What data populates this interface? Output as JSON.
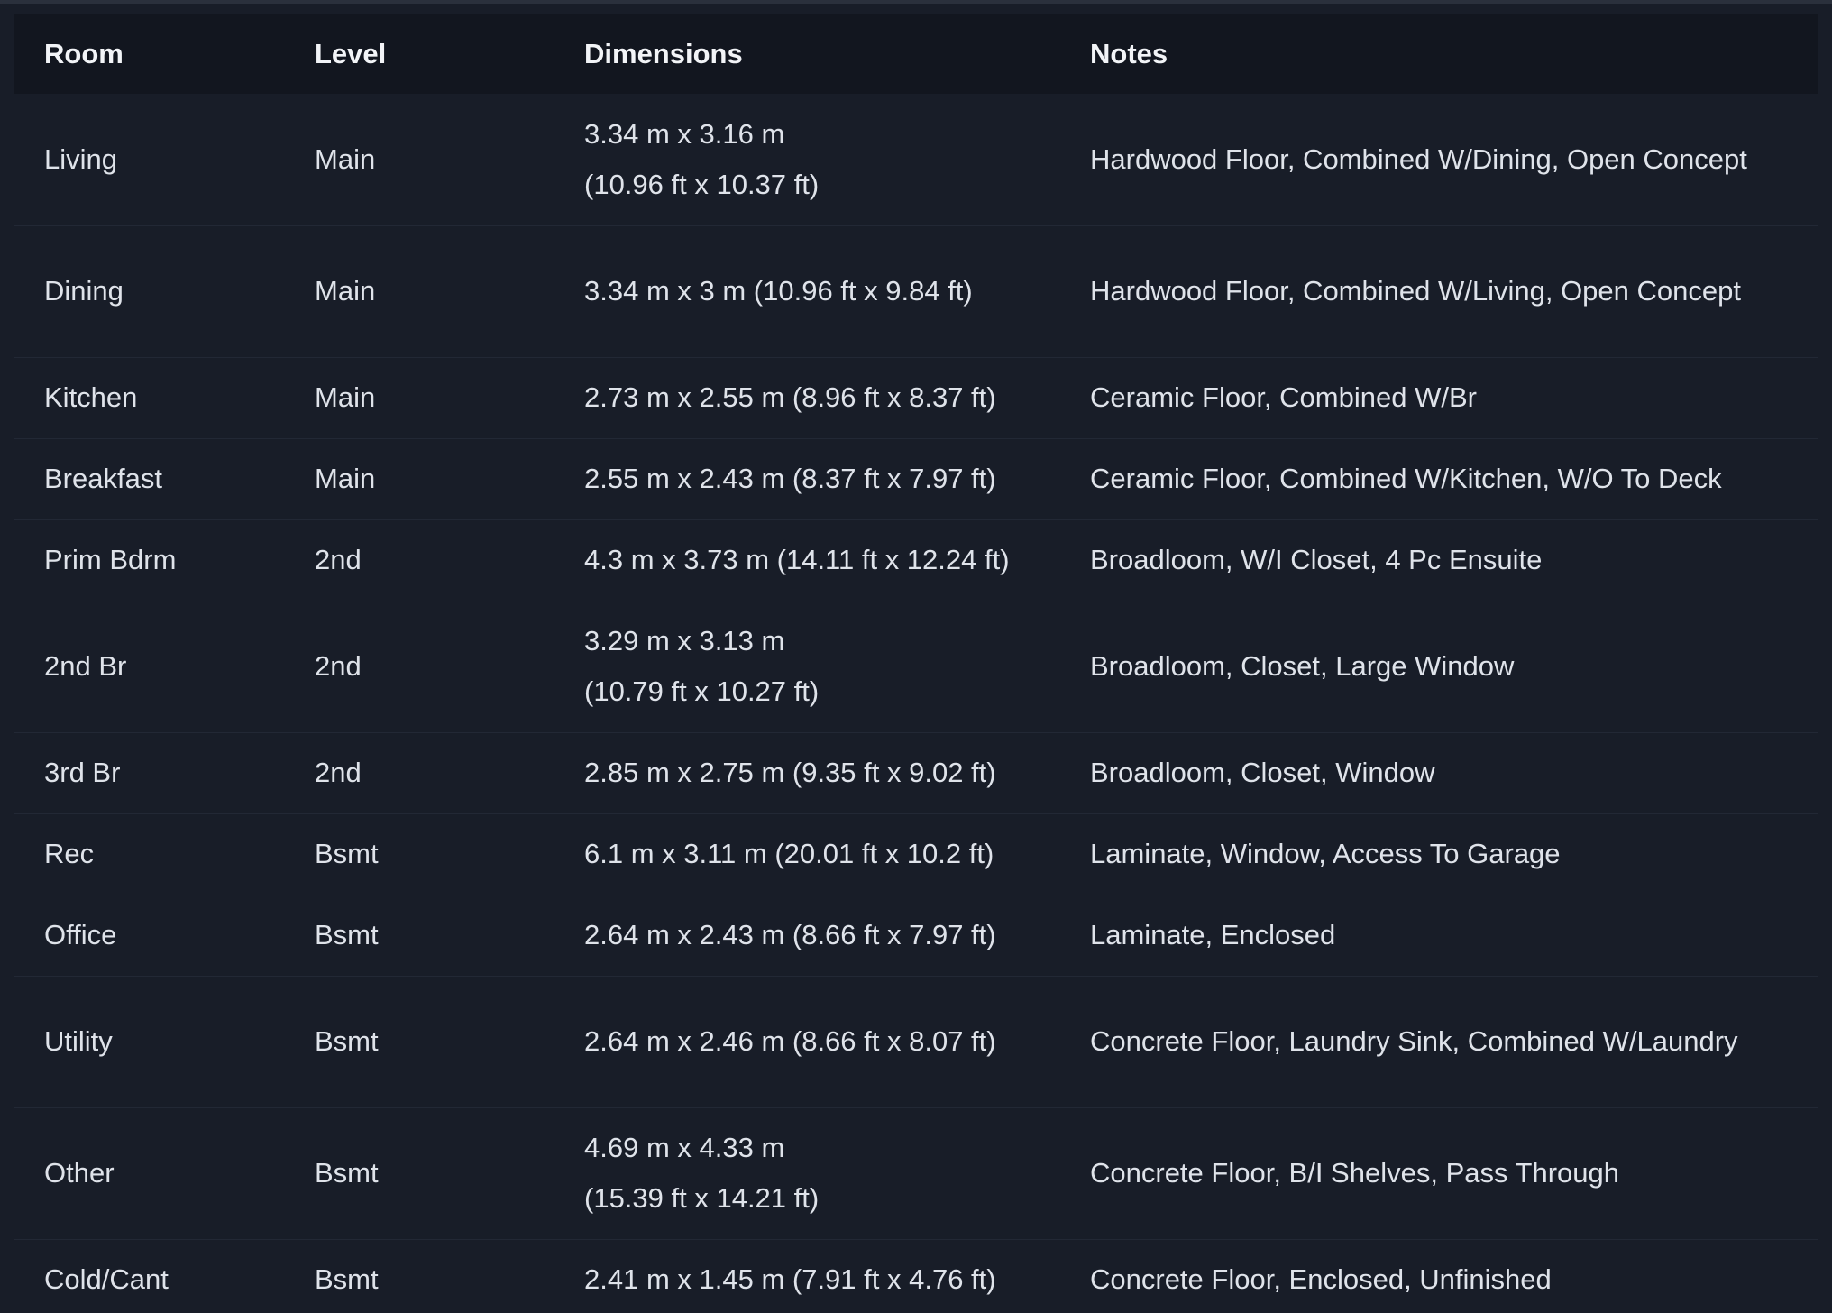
{
  "table": {
    "headers": {
      "room": "Room",
      "level": "Level",
      "dimensions": "Dimensions",
      "notes": "Notes"
    },
    "rows": [
      {
        "room": "Living",
        "level": "Main",
        "dim_m": "3.34 m x 3.16 m",
        "dim_ft": "(10.96 ft x 10.37 ft)",
        "dim_full": "",
        "notes": "Hardwood Floor, Combined W/Dining, Open Concept"
      },
      {
        "room": "Dining",
        "level": "Main",
        "dim_m": "",
        "dim_ft": "",
        "dim_full": "3.34 m x 3 m (10.96 ft x 9.84 ft)",
        "notes": "Hardwood Floor, Combined W/Living, Open Concept"
      },
      {
        "room": "Kitchen",
        "level": "Main",
        "dim_m": "",
        "dim_ft": "",
        "dim_full": "2.73 m x 2.55 m (8.96 ft x 8.37 ft)",
        "notes": "Ceramic Floor, Combined W/Br"
      },
      {
        "room": "Breakfast",
        "level": "Main",
        "dim_m": "",
        "dim_ft": "",
        "dim_full": "2.55 m x 2.43 m (8.37 ft x 7.97 ft)",
        "notes": "Ceramic Floor, Combined W/Kitchen, W/O To Deck"
      },
      {
        "room": "Prim Bdrm",
        "level": "2nd",
        "dim_m": "",
        "dim_ft": "",
        "dim_full": "4.3 m x 3.73 m (14.11 ft x 12.24 ft)",
        "notes": "Broadloom, W/I Closet, 4 Pc Ensuite"
      },
      {
        "room": "2nd Br",
        "level": "2nd",
        "dim_m": "3.29 m x 3.13 m",
        "dim_ft": "(10.79 ft x 10.27 ft)",
        "dim_full": "",
        "notes": "Broadloom, Closet, Large Window"
      },
      {
        "room": "3rd Br",
        "level": "2nd",
        "dim_m": "",
        "dim_ft": "",
        "dim_full": "2.85 m x 2.75 m (9.35 ft x 9.02 ft)",
        "notes": "Broadloom, Closet, Window"
      },
      {
        "room": "Rec",
        "level": "Bsmt",
        "dim_m": "",
        "dim_ft": "",
        "dim_full": "6.1 m x 3.11 m (20.01 ft x 10.2 ft)",
        "notes": "Laminate, Window, Access To Garage"
      },
      {
        "room": "Office",
        "level": "Bsmt",
        "dim_m": "",
        "dim_ft": "",
        "dim_full": "2.64 m x 2.43 m (8.66 ft x 7.97 ft)",
        "notes": "Laminate, Enclosed"
      },
      {
        "room": "Utility",
        "level": "Bsmt",
        "dim_m": "",
        "dim_ft": "",
        "dim_full": "2.64 m x 2.46 m (8.66 ft x 8.07 ft)",
        "notes": "Concrete Floor, Laundry Sink, Combined W/Laundry"
      },
      {
        "room": "Other",
        "level": "Bsmt",
        "dim_m": "4.69 m x 4.33 m",
        "dim_ft": "(15.39 ft x 14.21 ft)",
        "dim_full": "",
        "notes": "Concrete Floor, B/I Shelves, Pass Through"
      },
      {
        "room": "Cold/Cant",
        "level": "Bsmt",
        "dim_m": "",
        "dim_ft": "",
        "dim_full": "2.41 m x 1.45 m (7.91 ft x 4.76 ft)",
        "notes": "Concrete Floor, Enclosed, Unfinished"
      }
    ]
  }
}
